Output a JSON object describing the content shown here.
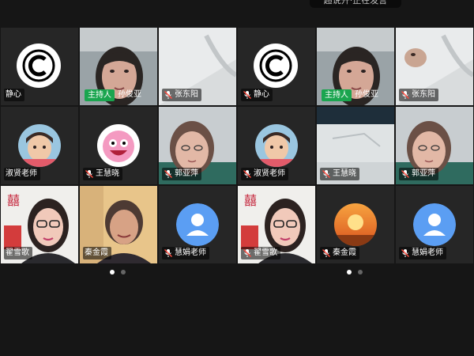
{
  "top_toast": "超说开·正在发言",
  "host_label": "主持人",
  "pages": [
    {
      "tiles": [
        {
          "name": "静心",
          "muted": false,
          "host": false,
          "kind": "logo"
        },
        {
          "name": "孙俊亚",
          "muted": false,
          "host": true,
          "kind": "face"
        },
        {
          "name": "张东阳",
          "muted": true,
          "host": false,
          "kind": "ceiling"
        },
        {
          "name": "淑贤老师",
          "muted": false,
          "host": false,
          "kind": "child"
        },
        {
          "name": "王慧晓",
          "muted": true,
          "host": false,
          "kind": "cartoon"
        },
        {
          "name": "郭亚萍",
          "muted": true,
          "host": false,
          "kind": "face2"
        },
        {
          "name": "翟雪歌",
          "muted": false,
          "host": false,
          "kind": "glasses"
        },
        {
          "name": "秦金霞",
          "muted": false,
          "host": false,
          "kind": "elder"
        },
        {
          "name": "慧娟老师",
          "muted": true,
          "host": false,
          "kind": "default"
        }
      ]
    },
    {
      "tiles": [
        {
          "name": "静心",
          "muted": true,
          "host": false,
          "kind": "logo"
        },
        {
          "name": "孙俊亚",
          "muted": false,
          "host": true,
          "kind": "face"
        },
        {
          "name": "张东阳",
          "muted": true,
          "host": false,
          "kind": "ceiling2"
        },
        {
          "name": "淑贤老师",
          "muted": true,
          "host": false,
          "kind": "child"
        },
        {
          "name": "王慧晓",
          "muted": true,
          "host": false,
          "kind": "room"
        },
        {
          "name": "郭亚萍",
          "muted": true,
          "host": false,
          "kind": "face2"
        },
        {
          "name": "翟雪歌",
          "muted": true,
          "host": false,
          "kind": "glasses"
        },
        {
          "name": "秦金霞",
          "muted": true,
          "host": false,
          "kind": "sunset"
        },
        {
          "name": "慧娟老师",
          "muted": true,
          "host": false,
          "kind": "default"
        }
      ]
    }
  ],
  "pagination": [
    {
      "active": true
    },
    {
      "active": false
    }
  ],
  "colors": {
    "host_badge": "#1aa54f",
    "default_avatar": "#5b9ef3",
    "background": "#161616"
  }
}
